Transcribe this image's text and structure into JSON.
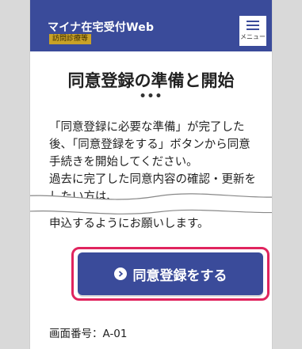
{
  "header": {
    "app_title": "マイナ在宅受付Web",
    "badge": "訪問診療等",
    "menu_label": "メニュー"
  },
  "main": {
    "title": "同意登録の準備と開始",
    "dots": "•••",
    "paragraph": "「同意登録に必要な準備」が完了した後、「同意登録をする」ボタンから同意手続きを開始してください。\n過去に完了した同意内容の確認・更新をしたい方は、",
    "paragraph_tail": "申込するようにお願いします。",
    "cta_label": "同意登録をする"
  },
  "footer": {
    "screen_number": "画面番号：A-01"
  },
  "colors": {
    "primary": "#3a4b9a",
    "badge": "#c9a227",
    "highlight": "#e0245e"
  }
}
